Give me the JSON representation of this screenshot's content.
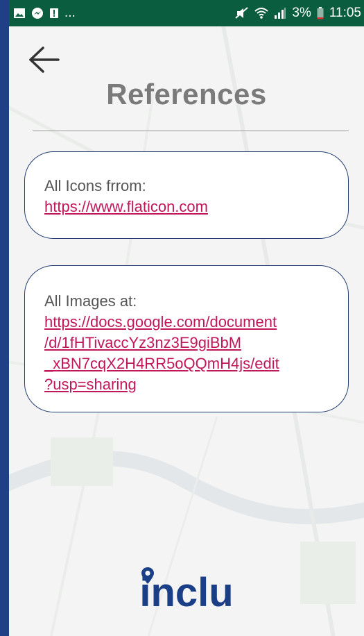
{
  "status_bar": {
    "more": "...",
    "battery_percent": "3%",
    "time": "11:05"
  },
  "page": {
    "title": "References"
  },
  "references": [
    {
      "label": "All Icons frrom:",
      "link_lines": [
        "https://www.flaticon.com"
      ]
    },
    {
      "label": "All Images at:",
      "link_lines": [
        "https://docs.google.com/document",
        "/d/1fHTivaccYz3nz3E9giBbM",
        "_xBN7cqX2H4RR5oQQmH4js/edit",
        "?usp=sharing"
      ]
    }
  ],
  "brand": {
    "logo_text": "inclu"
  },
  "colors": {
    "status_bar": "#0a5d3e",
    "frame": "#1f3f86",
    "title": "#7a7a7a",
    "link": "#c0175a",
    "card_border": "#233d73",
    "logo": "#1b3f86"
  },
  "icons": {
    "back": "arrow-left-icon",
    "status_left": [
      "gallery-icon",
      "messenger-icon",
      "alert-icon"
    ],
    "status_right": [
      "mute-icon",
      "wifi-icon",
      "signal-icon",
      "battery-icon"
    ]
  }
}
